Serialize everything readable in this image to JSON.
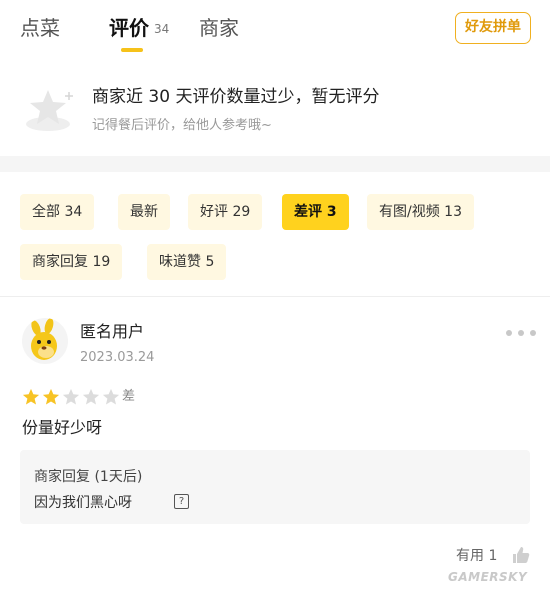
{
  "tabs": {
    "items": [
      {
        "label": "点菜"
      },
      {
        "label": "评价",
        "count": "34"
      },
      {
        "label": "商家"
      }
    ],
    "share_label": "好友拼单"
  },
  "notice": {
    "title": "商家近 30 天评价数量过少，暂无评分",
    "subtitle": "记得餐后评价，给他人参考哦~"
  },
  "filters": [
    {
      "label": "全部 34"
    },
    {
      "label": "最新"
    },
    {
      "label": "好评 29"
    },
    {
      "label": "差评 3",
      "active": true
    },
    {
      "label": "有图/视频 13"
    },
    {
      "label": "商家回复 19"
    },
    {
      "label": "味道赞 5"
    }
  ],
  "review": {
    "user": "匿名用户",
    "date": "2023.03.24",
    "stars_filled": 2,
    "stars_total": 5,
    "rating_label": "差",
    "text": "份量好少呀",
    "reply_title": "商家回复 (1天后)",
    "reply_text": "因为我们黑心呀",
    "reply_emoji": "?",
    "helpful_label": "有用 1"
  },
  "watermark": "GAMERSKY",
  "colors": {
    "accent": "#ffd21e",
    "chip_bg": "#fff8e1",
    "star_on": "#f7c325",
    "star_off": "#dcdcdc",
    "share_border": "#f0b020"
  }
}
